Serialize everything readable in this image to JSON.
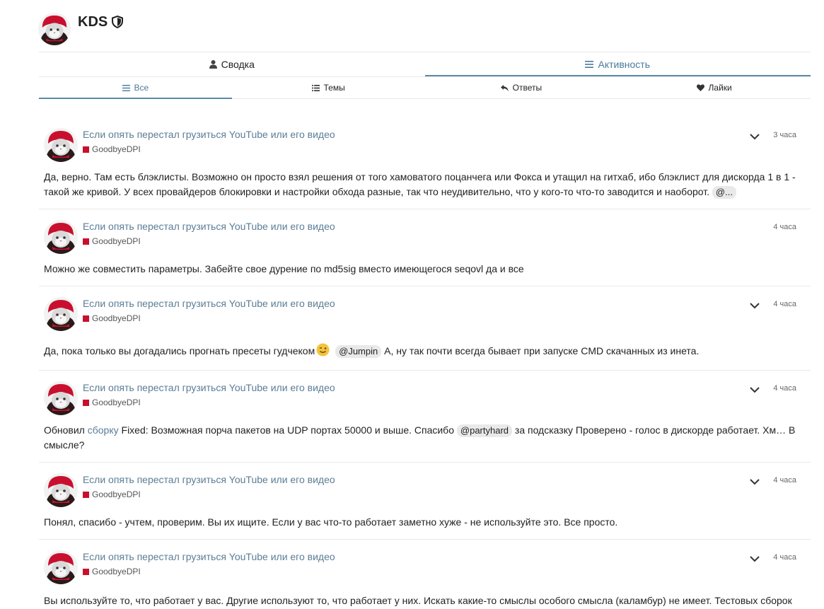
{
  "user": {
    "name": "KDS"
  },
  "tabs": {
    "summary": "Сводка",
    "activity": "Активность"
  },
  "subtabs": {
    "all": "Все",
    "topics": "Темы",
    "replies": "Ответы",
    "likes": "Лайки"
  },
  "colors": {
    "accent": "#5b8aa6",
    "link": "#5a7d96",
    "category": "#c8102e"
  },
  "posts": [
    {
      "title": "Если опять перестал грузиться YouTube или его видео",
      "category": "GoodbyeDPI",
      "time": "3 часа",
      "body_line1": "Да, верно. Там есть блэклисты. Возможно он просто взял решения от того хамоватого поцанчега или Фокса и утащил на гитхаб, ибо блэклист для дискорда 1 в 1 -",
      "body_line2": "такой же кривой. У всех провайдеров блокировки и настройки обхода разные, так что неудивительно, что у кого-то что-то заводится и наоборот.",
      "mention": "@..."
    },
    {
      "title": "Если опять перестал грузиться YouTube или его видео",
      "category": "GoodbyeDPI",
      "time": "4 часа",
      "body": "Можно же совместить параметры. Забейте свое дурение по md5sig вместо имеющегося seqovl да и все"
    },
    {
      "title": "Если опять перестал грузиться YouTube или его видео",
      "category": "GoodbyeDPI",
      "time": "4 часа",
      "body_a": "Да, пока только вы догадались прогнать пресеты гудчеком",
      "mention": "@Jumpin",
      "body_b": "А, ну так почти всегда бывает при запуске CMD скачанных из инета."
    },
    {
      "title": "Если опять перестал грузиться YouTube или его видео",
      "category": "GoodbyeDPI",
      "time": "4 часа",
      "body_a": "Обновил",
      "link": "сборку",
      "body_b": "Fixed: Возможная порча пакетов на UDP портах 50000 и выше. Спасибо",
      "mention": "@partyhard",
      "body_c": "за подсказку Проверено - голос в дискорде работает. Хм… В",
      "body_d": "смысле?"
    },
    {
      "title": "Если опять перестал грузиться YouTube или его видео",
      "category": "GoodbyeDPI",
      "time": "4 часа",
      "body": "Понял, спасибо - учтем, проверим. Вы их ищите. Если у вас что-то работает заметно хуже - не используйте это. Все просто."
    },
    {
      "title": "Если опять перестал грузиться YouTube или его видео",
      "category": "GoodbyeDPI",
      "time": "4 часа",
      "body": "Вы используйте то, что работает у вас. Другие используют то, что работает у них. Искать какие-то смыслы особого смысла (каламбур) не имеет. Тестовых сборок"
    }
  ]
}
